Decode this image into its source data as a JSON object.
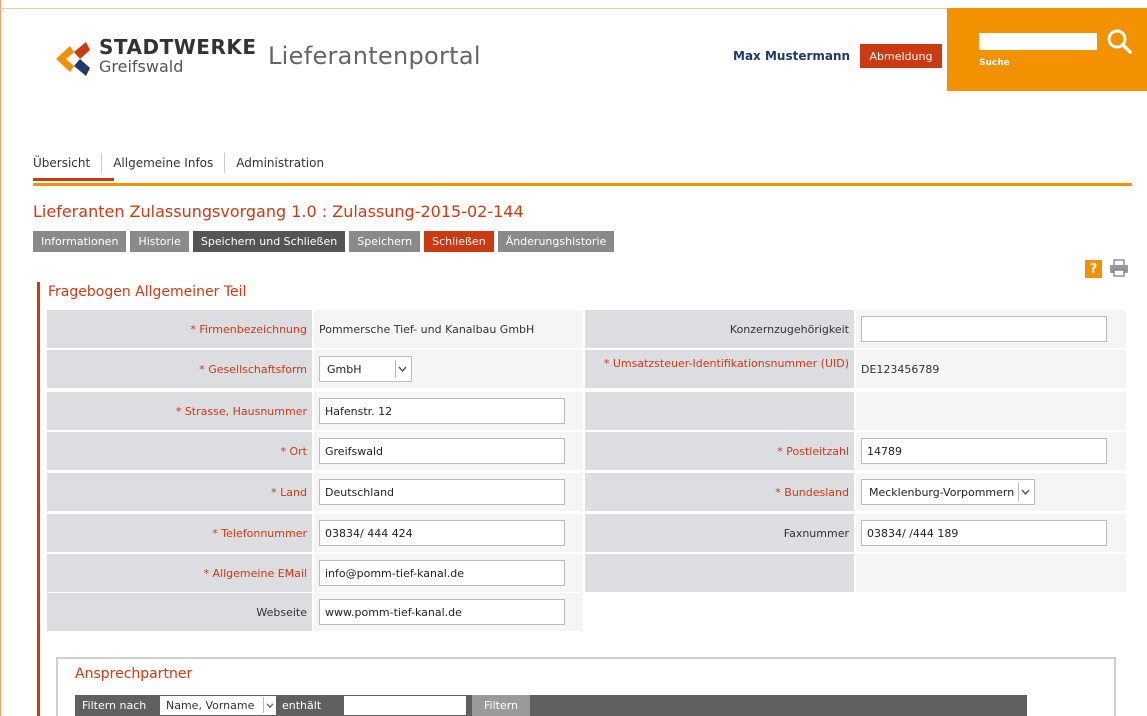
{
  "header": {
    "brand": "STADTWERKE",
    "city": "Greifswald",
    "portal_title": "Lieferantenportal",
    "user_name": "Max Mustermann",
    "logout_label": "Abmeldung",
    "search_label": "Suche",
    "search_value": ""
  },
  "colors": {
    "accent_orange": "#f39200",
    "accent_red": "#cc3a12",
    "label_grey": "#dcdde1"
  },
  "nav": {
    "items": [
      {
        "label": "Übersicht",
        "active": true
      },
      {
        "label": "Allgemeine Infos",
        "active": false
      },
      {
        "label": "Administration",
        "active": false
      }
    ]
  },
  "page": {
    "heading": "Lieferanten Zulassungsvorgang 1.0 : Zulassung-2015-02-144"
  },
  "toolbar": {
    "buttons": [
      {
        "label": "Informationen",
        "style": "grey"
      },
      {
        "label": "Historie",
        "style": "grey"
      },
      {
        "label": "Speichern und Schließen",
        "style": "dark"
      },
      {
        "label": "Speichern",
        "style": "grey"
      },
      {
        "label": "Schließen",
        "style": "red"
      },
      {
        "label": "Änderungshistorie",
        "style": "grey"
      }
    ]
  },
  "icons": {
    "help": "?",
    "print": "printer-icon"
  },
  "form": {
    "section_title": "Fragebogen Allgemeiner Teil",
    "firmenbezeichnung": {
      "label": "* Firmenbezeichnung",
      "value": "Pommersche Tief- und Kanalbau GmbH"
    },
    "konzern": {
      "label": "Konzernzugehörigkeit",
      "value": ""
    },
    "gesellschaftsform": {
      "label": "* Gesellschaftsform",
      "value": "GmbH"
    },
    "uid": {
      "label": "* Umsatzsteuer-Identifikationsnummer (UID)",
      "value": "DE123456789"
    },
    "strasse": {
      "label": "* Strasse, Hausnummer",
      "value": "Hafenstr. 12"
    },
    "ort": {
      "label": "* Ort",
      "value": "Greifswald"
    },
    "plz": {
      "label": "* Postleitzahl",
      "value": "14789"
    },
    "land": {
      "label": "* Land",
      "value": "Deutschland"
    },
    "bundesland": {
      "label": "* Bundesland",
      "value": "Mecklenburg-Vorpommern"
    },
    "telefon": {
      "label": "* Telefonnummer",
      "value": "03834/ 444 424"
    },
    "fax": {
      "label": "Faxnummer",
      "value": "03834/ /444 189"
    },
    "email": {
      "label": "* Allgemeine EMail",
      "value": "info@pomm-tief-kanal.de"
    },
    "webseite": {
      "label": "Webseite",
      "value": "www.pomm-tief-kanal.de"
    }
  },
  "contacts": {
    "title": "Ansprechpartner",
    "filter_label": "Filtern nach",
    "filter_field": "Name, Vorname",
    "contains_label": "enthält",
    "filter_value": "",
    "filter_button": "Filtern"
  }
}
